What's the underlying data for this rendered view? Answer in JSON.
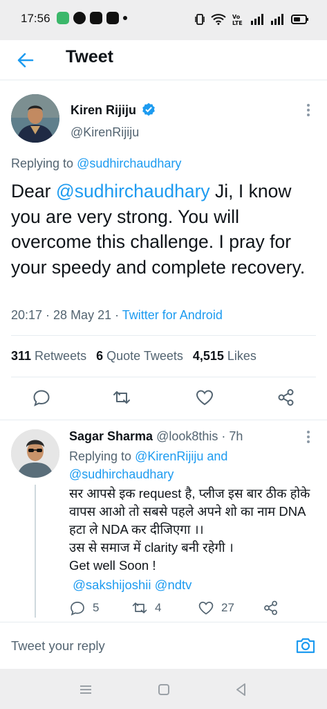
{
  "status_bar": {
    "time": "17:56"
  },
  "header": {
    "title": "Tweet"
  },
  "tweet": {
    "author_name": "Kiren Rijiju",
    "author_handle": "@KirenRijiju",
    "replying_prefix": "Replying to ",
    "replying_to": "@sudhirchaudhary",
    "text_mention": "@sudhirchaudhary",
    "text_prefix": "Dear ",
    "text_body": " Ji, I know you are very strong. You will overcome this challenge. I pray for your speedy and complete recovery.",
    "timestamp": "20:17 · 28 May 21 · ",
    "source": "Twitter for Android",
    "retweets_count": "311",
    "retweets_label": " Retweets",
    "quotes_count": "6",
    "quotes_label": " Quote Tweets",
    "likes_count": "4,515",
    "likes_label": " Likes"
  },
  "reply": {
    "author_name": "Sagar Sharma",
    "author_handle": "@look8this",
    "time": " · 7h",
    "replying_prefix": "Replying to ",
    "replying_to_1": "@KirenRijiju",
    "replying_and": " and",
    "replying_to_2": "@sudhirchaudhary",
    "line1": "सर आपसे इक request है, प्लीज इस बार ठीक होके वापस आओ तो सबसे पहले अपने शो का नाम DNA हटा ले NDA कर दीजिएगा ।।",
    "line2": "उस से समाज में clarity बनी रहेगी ।",
    "line3": "Get well Soon !",
    "mention1": "@sakshijoshii",
    "mention2": "@ndtv",
    "reply_count": "5",
    "retweet_count": "4",
    "like_count": "27"
  },
  "composer": {
    "placeholder": "Tweet your reply"
  },
  "colors": {
    "accent": "#1d9bf0",
    "secondary_text": "#536471",
    "divider": "#e6ecf0"
  },
  "icons": [
    "back-arrow-icon",
    "verified-badge-icon",
    "more-vertical-icon",
    "reply-icon",
    "retweet-icon",
    "like-icon",
    "share-icon",
    "camera-icon"
  ]
}
